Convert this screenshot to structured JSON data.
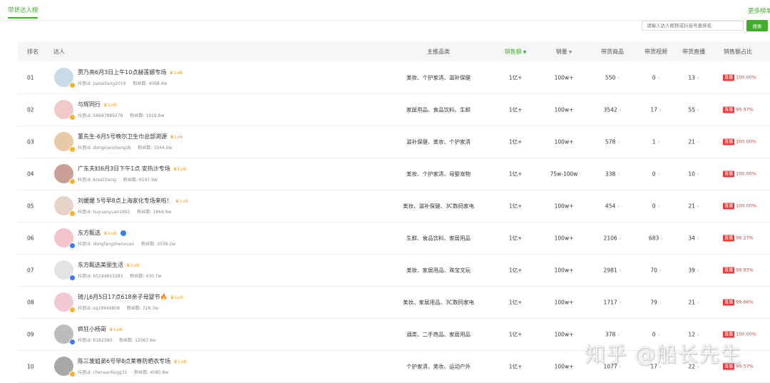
{
  "top": {
    "active_tab": "带货达人榜",
    "more_link": "更多榜单"
  },
  "search": {
    "placeholder": "请输入达人昵称或抖音号查排名",
    "button": "搜索"
  },
  "columns": {
    "rank": "排名",
    "talent": "达人",
    "categories": "主推品类",
    "sales_amount": "销售额",
    "sales_volume": "销量",
    "products": "带货商品",
    "videos": "带货视频",
    "lives": "带货直播",
    "share": "销售额占比"
  },
  "labels": {
    "douyin_id": "抖音id:",
    "fans": "粉丝数:",
    "live": "直播"
  },
  "rows": [
    {
      "rank": "01",
      "name": "贾乃亮6月3日上午10点赫莲娜专场",
      "lv": "Lv6",
      "id": "jianailiang2019",
      "fans": "4068.4w",
      "cat": "美妆、个护家清、滋补保健",
      "amount": "1亿+",
      "volume": "100w+",
      "products": "550",
      "videos": "0",
      "lives": "13",
      "share": "100.00%",
      "fire": false,
      "verify": false
    },
    {
      "rank": "02",
      "name": "与辉同行",
      "lv": "Lv6",
      "id": "56687889278",
      "fans": "1919.8w",
      "cat": "家居用品、食品饮料、生鲜",
      "amount": "1亿+",
      "volume": "100w+",
      "products": "3542",
      "videos": "17",
      "lives": "55",
      "share": "99.97%",
      "fire": false,
      "verify": false
    },
    {
      "rank": "03",
      "name": "董先生-6月5号晚尔卫生巾总部溯源",
      "lv": "Lv6",
      "id": "dongxianshengzb",
      "fans": "3344.0w",
      "cat": "滋补保健、美妆、个护家清",
      "amount": "1亿+",
      "volume": "100w+",
      "products": "578",
      "videos": "1",
      "lives": "21",
      "share": "100.00%",
      "fire": false,
      "verify": false
    },
    {
      "rank": "04",
      "name": "广东夫妇6月3日下午1点 安热沙专场",
      "lv": "Lv6",
      "id": "AresCheng",
      "fans": "6147.9w",
      "cat": "美妆、个护家清、母婴宠物",
      "amount": "1亿+",
      "volume": "75w-100w",
      "products": "338",
      "videos": "0",
      "lives": "10",
      "share": "100.00%",
      "fire": false,
      "verify": false
    },
    {
      "rank": "05",
      "name": "刘媛媛 5号早8点上海家化专场来啦！",
      "lv": "Lv6",
      "id": "liuyuanyuan1991",
      "fans": "1864.9w",
      "cat": "美妆、滋补保健、3C数码家电",
      "amount": "1亿+",
      "volume": "100w+",
      "products": "454",
      "videos": "0",
      "lives": "21",
      "share": "100.00%",
      "fire": false,
      "verify": false
    },
    {
      "rank": "06",
      "name": "东方甄选",
      "lv": "Lv6",
      "id": "dongfangzhenxuan",
      "fans": "3038.2w",
      "cat": "生鲜、食品饮料、家居用品",
      "amount": "1亿+",
      "volume": "100w+",
      "products": "2106",
      "videos": "683",
      "lives": "34",
      "share": "98.27%",
      "fire": false,
      "verify": true
    },
    {
      "rank": "07",
      "name": "东方甄选美丽生活",
      "lv": "Lv6",
      "id": "95144613283",
      "fans": "430.7w",
      "cat": "美妆、家居用品、珠宝文玩",
      "amount": "1亿+",
      "volume": "100w+",
      "products": "2981",
      "videos": "70",
      "lives": "39",
      "share": "99.93%",
      "fire": false,
      "verify": false
    },
    {
      "rank": "08",
      "name": "琦儿6月5日17点618亲子母婴节",
      "lv": "Lv6",
      "id": "sq19940808",
      "fans": "728.3w",
      "cat": "美妆、家居用品、3C数码家电",
      "amount": "1亿+",
      "volume": "100w+",
      "products": "1717",
      "videos": "79",
      "lives": "21",
      "share": "99.66%",
      "fire": true,
      "verify": false
    },
    {
      "rank": "09",
      "name": "疯狂小杨哥",
      "lv": "Lv6",
      "id": "6182390",
      "fans": "12067.6w",
      "cat": "酒类、二手商品、家居用品",
      "amount": "1亿+",
      "volume": "100w+",
      "products": "378",
      "videos": "0",
      "lives": "12",
      "share": "100.00%",
      "fire": false,
      "verify": false
    },
    {
      "rank": "10",
      "name": "陈三废姐弟6号早8点莱尊防晒衣专场",
      "lv": "Lv6",
      "id": "chensanfeigg31",
      "fans": "4085.8w",
      "cat": "个护家清、美妆、运动户外",
      "amount": "1亿+",
      "volume": "100w+",
      "products": "1077",
      "videos": "17",
      "lives": "22",
      "share": "99.57%",
      "fire": false,
      "verify": false
    }
  ],
  "avatar_colors": [
    "#c7dbe8",
    "#f1c9c9",
    "#e8c9a8",
    "#c9a093",
    "#e7d3c7",
    "#f3c4cc",
    "#e3e3e3",
    "#f0c9d2",
    "#bcbcbc",
    "#a8a8a8"
  ],
  "badge_colors": [
    "#f4b32a",
    "#f4b32a",
    "#f4b32a",
    "#f4b32a",
    "#f4b32a",
    "#3d7bf0",
    "#3d7bf0",
    "#f4b32a",
    "#3d7bf0",
    "#f4b32a"
  ],
  "watermark": "知乎 @船长先生",
  "colors": {
    "accent": "#3fae29",
    "live": "#ea3b3b",
    "level": "#f39a1a"
  }
}
